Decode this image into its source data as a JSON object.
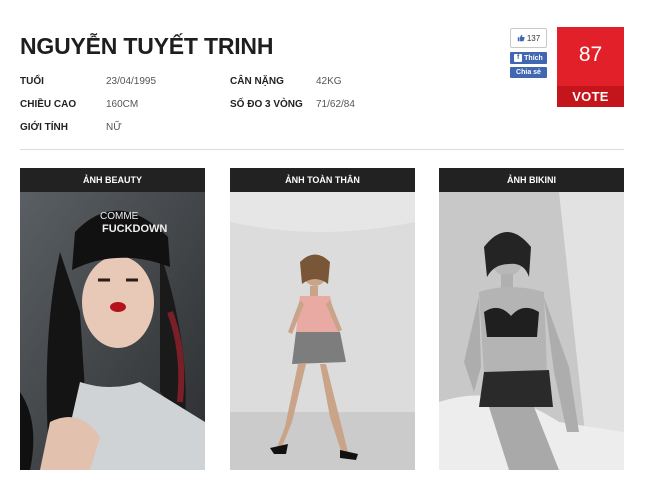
{
  "profile": {
    "name": "NGUYỄN TUYẾT TRINH",
    "age_label": "TUỔI",
    "age_value": "23/04/1995",
    "height_label": "CHIỀU CAO",
    "height_value": "160CM",
    "gender_label": "GIỚI TÍNH",
    "gender_value": "NỮ",
    "weight_label": "CÂN NẶNG",
    "weight_value": "42KG",
    "measurements_label": "SỐ ĐO 3 VÒNG",
    "measurements_value": "71/62/84"
  },
  "facebook": {
    "like_count": "137",
    "like_icon": "thumbs-up-icon",
    "like_label": "Thích",
    "share_label": "Chia sẻ",
    "brand_color": "#4267b2"
  },
  "vote": {
    "count": "87",
    "button_label": "VOTE",
    "accent_color": "#e2202a"
  },
  "gallery": {
    "columns": [
      {
        "title": "ẢNH BEAUTY"
      },
      {
        "title": "ẢNH TOÀN THÂN"
      },
      {
        "title": "ẢNH BIKINI"
      }
    ],
    "beauty_hat_text_1": "COMME",
    "beauty_hat_text_2": "FUCKDOWN"
  }
}
